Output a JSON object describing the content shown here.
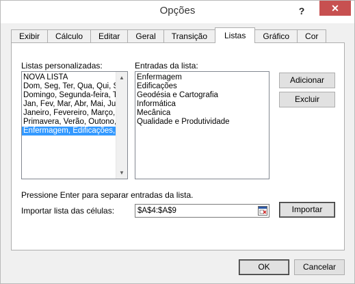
{
  "window": {
    "title": "Opções",
    "help_glyph": "?",
    "close_glyph": "✕"
  },
  "tabs": [
    {
      "label": "Exibir"
    },
    {
      "label": "Cálculo"
    },
    {
      "label": "Editar"
    },
    {
      "label": "Geral"
    },
    {
      "label": "Transição"
    },
    {
      "label": "Listas",
      "active": true
    },
    {
      "label": "Gráfico"
    },
    {
      "label": "Cor"
    }
  ],
  "lists_panel": {
    "custom_lists_label": "Listas personalizadas:",
    "custom_lists": [
      "NOVA LISTA",
      "Dom, Seg, Ter, Qua, Qui, Se",
      "Domingo, Segunda-feira, Te",
      "Jan, Fev, Mar, Abr, Mai, Jun",
      "Janeiro, Fevereiro, Março, A",
      "Primavera, Verão, Outono, I",
      "Enfermagem, Edificações, G"
    ],
    "selected_index": 6,
    "entries_label": "Entradas da lista:",
    "entries": [
      "Enfermagem",
      "Edificações",
      "Geodésia e Cartografia",
      "Informática",
      "Mecânica",
      "Qualidade e Produtividade"
    ],
    "add_button": "Adicionar",
    "delete_button": "Excluir",
    "hint": "Pressione Enter para separar entradas da lista.",
    "import_label": "Importar lista das células:",
    "import_value": "$A$4:$A$9",
    "import_button": "Importar"
  },
  "footer": {
    "ok_label": "OK",
    "cancel_label": "Cancelar"
  },
  "icons": {
    "scroll_up": "up-arrow-icon",
    "scroll_down": "down-arrow-icon",
    "ref_edit": "collapse-dialog-icon"
  }
}
